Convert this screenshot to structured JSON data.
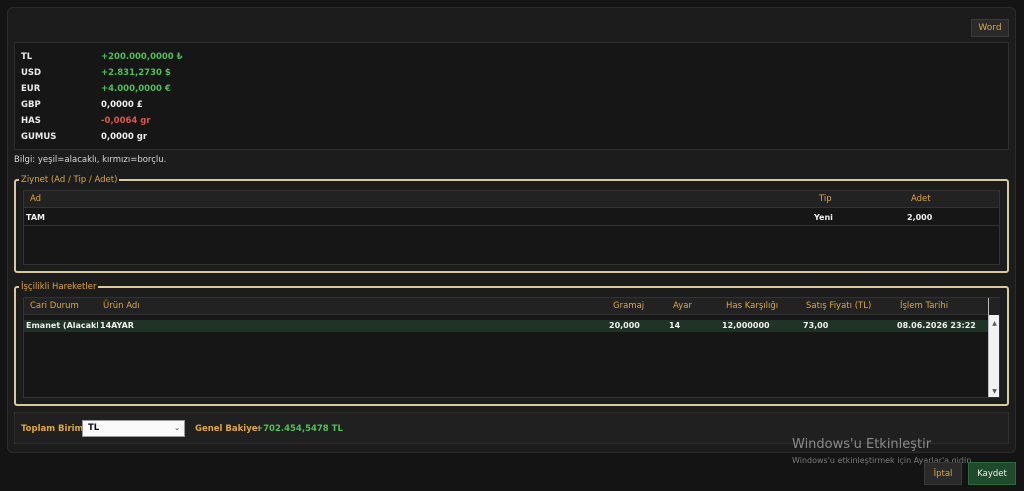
{
  "toolbar": {
    "word_label": "Word"
  },
  "balances": [
    {
      "currency": "TL",
      "value": "+200.000,0000 ₺",
      "state": "pos"
    },
    {
      "currency": "USD",
      "value": "+2.831,2730 $",
      "state": "pos"
    },
    {
      "currency": "EUR",
      "value": "+4.000,0000 €",
      "state": "pos"
    },
    {
      "currency": "GBP",
      "value": "0,0000 £",
      "state": "neu"
    },
    {
      "currency": "HAS",
      "value": "-0,0064 gr",
      "state": "neg"
    },
    {
      "currency": "GUMUS",
      "value": "0,0000 gr",
      "state": "neu"
    }
  ],
  "info": "Bilgi: yeşil=alacaklı, kırmızı=borçlu.",
  "ziynet": {
    "title": "Ziynet (Ad / Tip / Adet)",
    "columns": [
      "Ad",
      "Tip",
      "Adet"
    ],
    "rows": [
      [
        "TAM",
        "Yeni",
        "2,000"
      ]
    ]
  },
  "iscilik": {
    "title": "İşçilikli Hareketler",
    "columns": [
      "Cari Durum",
      "Ürün Adı",
      "Gramaj",
      "Ayar",
      "Has Karşılığı",
      "Satış Fiyatı (TL)",
      "İşlem Tarihi"
    ],
    "rows": [
      [
        "Emanet (Alacaklı)",
        "14AYAR",
        "20,000",
        "14",
        "12,000000",
        "73,00",
        "08.06.2026 23:22"
      ]
    ]
  },
  "footer": {
    "total_unit_label": "Toplam Birim:",
    "total_unit_value": "TL",
    "general_balance_label": "Genel Bakiye:",
    "general_balance_value": "+702.454,5478 TL"
  },
  "watermark": {
    "title": "Windows'u Etkinleştir",
    "subtitle": "Windows'u etkinleştirmek için Ayarlar'a gidin."
  },
  "actions": {
    "cancel_label": "İptal",
    "save_label": "Kaydet"
  }
}
